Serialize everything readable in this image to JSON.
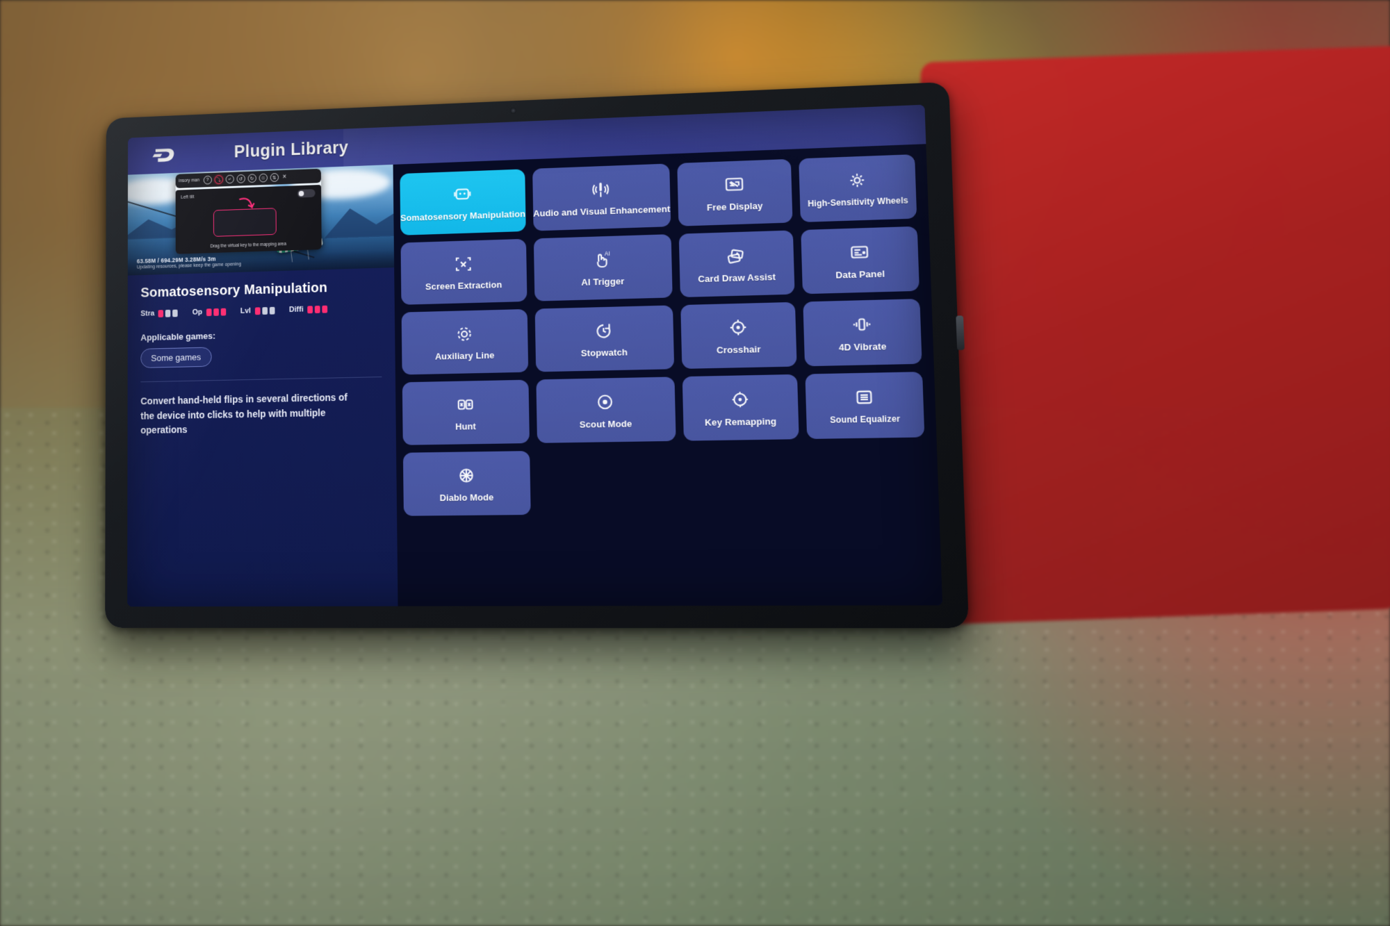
{
  "appbar": {
    "title": "Plugin Library",
    "logo_icon": "gamespace-d-logo-icon"
  },
  "detail": {
    "preview": {
      "mapping_dialog": {
        "app_name": "insory man",
        "toolbar_icons": [
          "help-icon",
          "gesture-active-icon",
          "gesture-icon",
          "rotate-icon",
          "cursor-icon",
          "tilt-icon",
          "flip-icon"
        ],
        "close_icon": "close-icon",
        "left_tilt_label": "Left tilt",
        "toggle_state": "off",
        "hint": "Drag the virtual key to the mapping area",
        "arrow_icon": "curved-arrow-icon"
      },
      "download_progress": "63.58M / 694.29M 3.28M/s    3m",
      "download_note": "Updating resources, please keep the game opening"
    },
    "title": "Somatosensory Manipulation",
    "ratings": [
      {
        "label": "Stra",
        "filled": 1,
        "total": 3
      },
      {
        "label": "Op",
        "filled": 3,
        "total": 3
      },
      {
        "label": "Lvl",
        "filled": 1,
        "total": 3
      },
      {
        "label": "Diffi",
        "filled": 3,
        "total": 3
      }
    ],
    "applicable_label": "Applicable games:",
    "game_tags": [
      "Some games"
    ],
    "description": "Convert hand-held flips in several directions of the device into clicks to help with multiple operations"
  },
  "grid": {
    "tiles": [
      {
        "label": "Somatosensory Manipulation",
        "icon": "somatosensory-icon",
        "selected": true
      },
      {
        "label": "Audio and Visual Enhancement",
        "icon": "audio-visual-icon",
        "selected": false
      },
      {
        "label": "Free Display",
        "icon": "free-display-icon",
        "selected": false
      },
      {
        "label": "High-Sensitivity Wheels",
        "icon": "high-sensitivity-wheels-icon",
        "selected": false
      },
      {
        "label": "Screen Extraction",
        "icon": "screen-extraction-icon",
        "selected": false
      },
      {
        "label": "AI Trigger",
        "icon": "ai-trigger-icon",
        "selected": false
      },
      {
        "label": "Card Draw Assist",
        "icon": "card-draw-assist-icon",
        "selected": false
      },
      {
        "label": "Data Panel",
        "icon": "data-panel-icon",
        "selected": false
      },
      {
        "label": "Auxiliary Line",
        "icon": "auxiliary-line-icon",
        "selected": false
      },
      {
        "label": "Stopwatch",
        "icon": "stopwatch-icon",
        "selected": false
      },
      {
        "label": "Crosshair",
        "icon": "crosshair-icon",
        "selected": false
      },
      {
        "label": "4D Vibrate",
        "icon": "vibrate-icon",
        "selected": false
      },
      {
        "label": "Hunt",
        "icon": "hunt-icon",
        "selected": false
      },
      {
        "label": "Scout Mode",
        "icon": "scout-mode-icon",
        "selected": false
      },
      {
        "label": "Key Remapping",
        "icon": "key-remapping-icon",
        "selected": false
      },
      {
        "label": "Sound Equalizer",
        "icon": "sound-equalizer-icon",
        "selected": false
      },
      {
        "label": "Diablo Mode",
        "icon": "diablo-mode-icon",
        "selected": false
      }
    ]
  },
  "colors": {
    "accent_selected": "#12b7e8",
    "tile": "#4c5aa8",
    "appbar": "#3a4193",
    "rating_filled": "#ff2d72",
    "rating_empty": "#c9cede"
  }
}
